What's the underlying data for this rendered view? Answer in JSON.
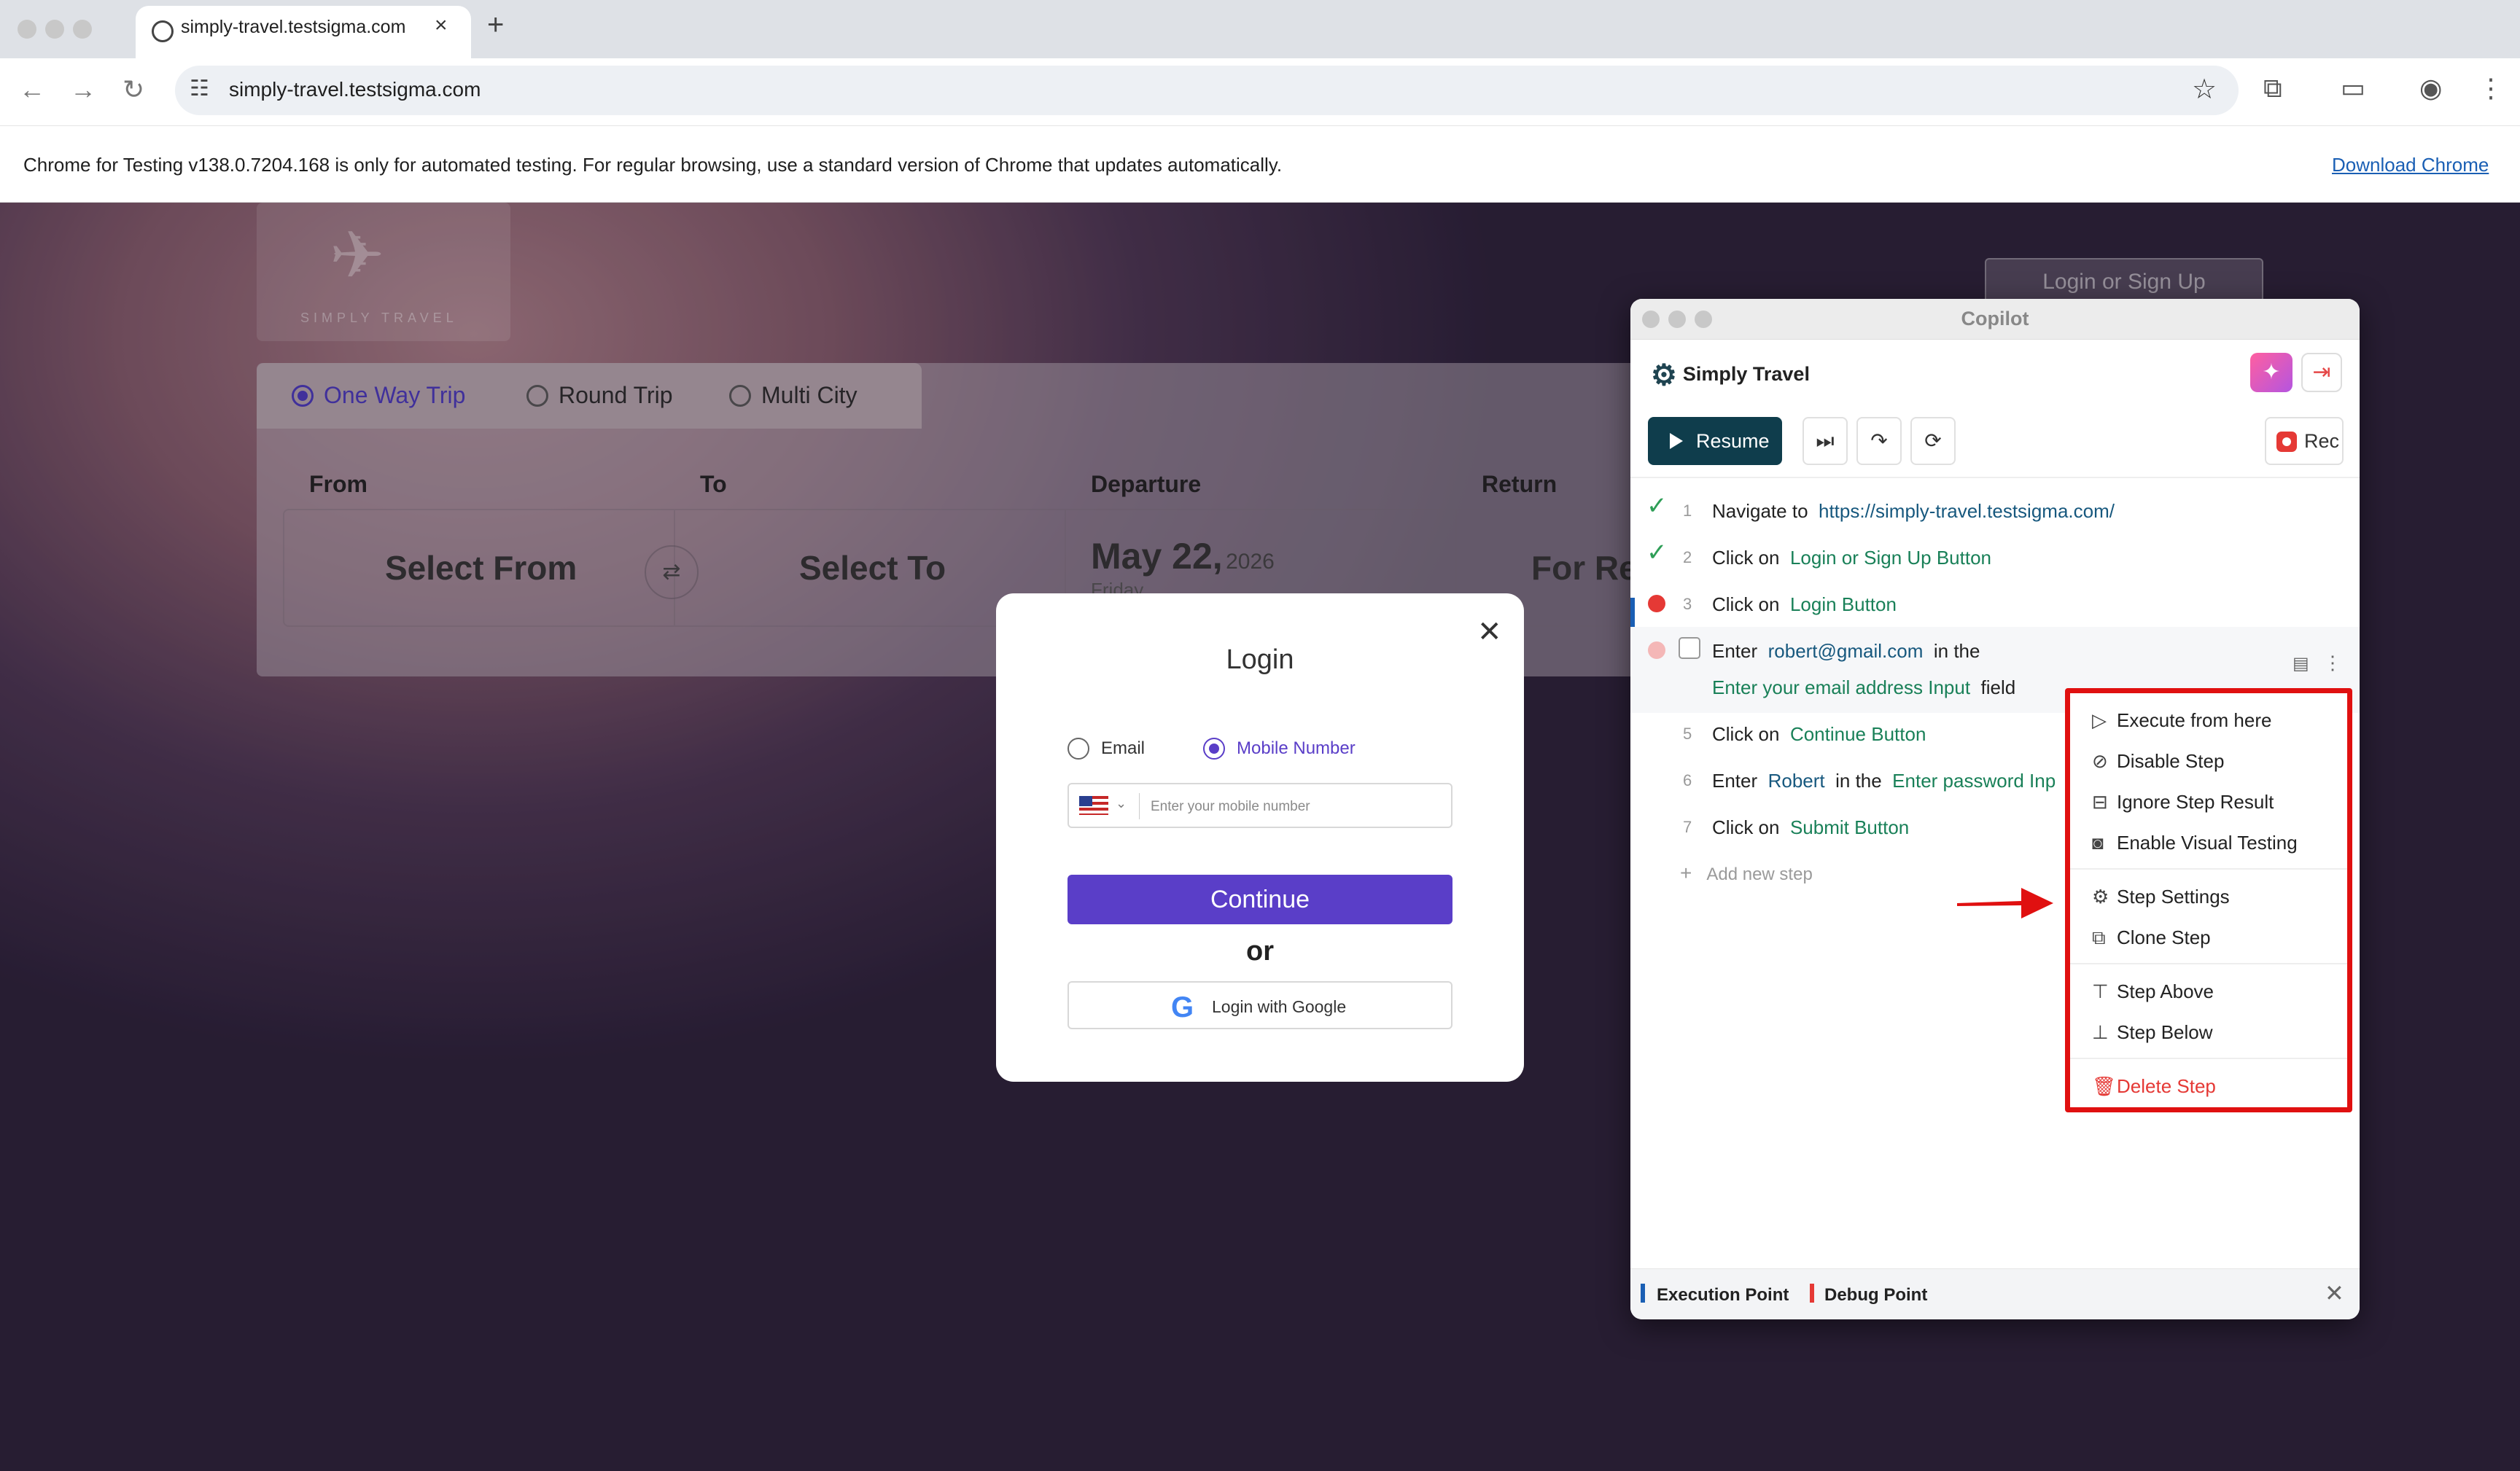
{
  "browser": {
    "tab_title": "simply-travel.testsigma.com",
    "new_tab": "+",
    "url": "simply-travel.testsigma.com",
    "info_message": "Chrome for Testing v138.0.7204.168 is only for automated testing. For regular browsing, use a standard version of Chrome that updates automatically.",
    "download_link": "Download Chrome"
  },
  "site": {
    "logo_text": "SIMPLY TRAVEL",
    "login_signup": "Login or Sign Up",
    "trip_types": [
      "One Way Trip",
      "Round Trip",
      "Multi City"
    ],
    "field_labels": {
      "from": "From",
      "to": "To",
      "departure": "Departure",
      "return": "Return"
    },
    "from_value": "Select From",
    "to_value": "Select To",
    "departure_date": "May 22,",
    "departure_year": "2026",
    "departure_day": "Friday",
    "return_value": "For Re"
  },
  "login_modal": {
    "title": "Login",
    "option_email": "Email",
    "option_mobile": "Mobile Number",
    "phone_placeholder": "Enter your mobile number",
    "continue": "Continue",
    "or": "or",
    "google": "Login with Google"
  },
  "copilot": {
    "window_title": "Copilot",
    "project": "Simply Travel",
    "resume": "Resume",
    "rec": "Rec",
    "steps": [
      {
        "num": "1",
        "action": "Navigate to",
        "target": "https://simply-travel.testsigma.com/",
        "status": "passed"
      },
      {
        "num": "2",
        "action": "Click on",
        "target": "Login or Sign Up Button",
        "status": "passed"
      },
      {
        "num": "3",
        "action": "Click on",
        "target": "Login Button",
        "status": "failed"
      },
      {
        "num": "",
        "action": "Enter",
        "value": "robert@gmail.com",
        "mid": "in the",
        "target": "Enter your email address Input",
        "suffix": "field",
        "status": "pending"
      },
      {
        "num": "5",
        "action": "Click on",
        "target": "Continue Button"
      },
      {
        "num": "6",
        "action": "Enter",
        "value": "Robert",
        "mid": "in the",
        "target": "Enter password Inp"
      },
      {
        "num": "7",
        "action": "Click on",
        "target": "Submit Button"
      }
    ],
    "add_step": "Add new step",
    "legend": {
      "execution": "Execution Point",
      "debug": "Debug Point"
    }
  },
  "context_menu": {
    "items": [
      "Execute from here",
      "Disable Step",
      "Ignore Step Result",
      "Enable Visual Testing",
      "Step Settings",
      "Clone Step",
      "Step Above",
      "Step Below",
      "Delete Step"
    ]
  },
  "colors": {
    "accent": "#5a3ec8",
    "copilot_dark": "#0f3d4c",
    "highlight": "#e01010",
    "link": "#17587e",
    "target": "#198058"
  }
}
